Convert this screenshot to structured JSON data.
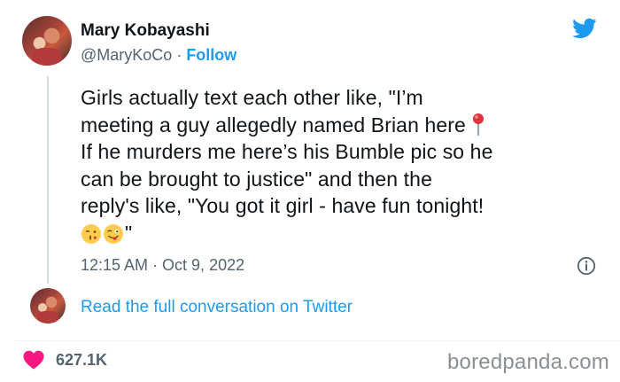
{
  "author": {
    "name": "Mary Kobayashi",
    "handle": "@MaryKoCo",
    "separator": " · ",
    "follow_label": "Follow"
  },
  "tweet": {
    "text": "Girls actually text each other like, \"I’m meeting a guy allegedly named Brian here \nIf he murders me here’s his Bumble pic so he can be brought to justice\" and then the reply's like, \"You got it girl - have fun tonight!",
    "text_line1": "Girls actually text each other like, \"I’m",
    "text_line2": "meeting a guy allegedly named Brian here",
    "text_line3": "If he murders me here’s his Bumble pic so he",
    "text_line4": "can be brought to justice\" and then the",
    "text_line5": "reply's like, \"You got it girl - have fun tonight!",
    "closing_quote": "\"",
    "emojis": [
      "kissing-face-icon",
      "winking-tongue-face-icon"
    ],
    "timestamp": "12:15 AM · Oct 9, 2022"
  },
  "conversation": {
    "link_text": "Read the full conversation on Twitter"
  },
  "engagement": {
    "likes": "627.1K"
  },
  "watermark": "boredpanda.com",
  "colors": {
    "accent": "#1d9bf0",
    "heart": "#f91880",
    "muted": "#536471"
  }
}
